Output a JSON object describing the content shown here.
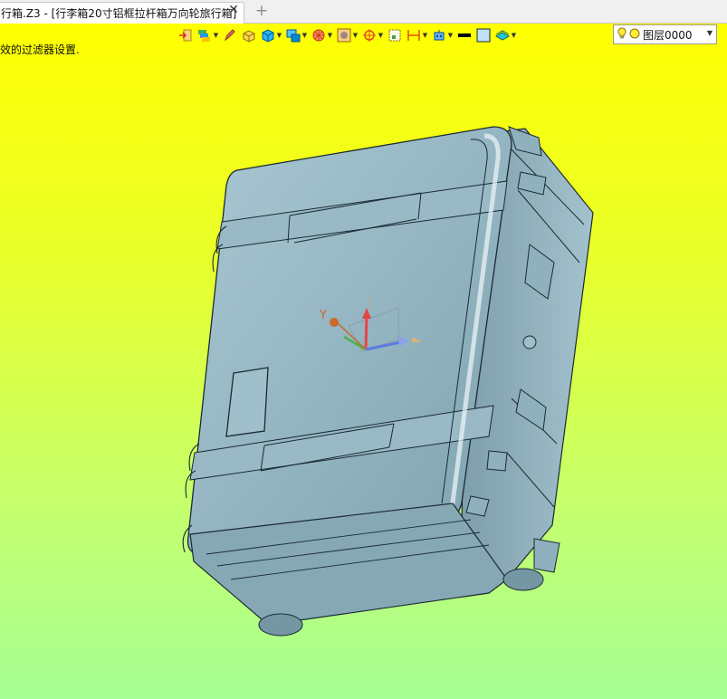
{
  "tab": {
    "title": "行箱.Z3 - [行李箱20寸铝框拉杆箱万向轮旅行箱]",
    "close_glyph": "✕",
    "new_tab_glyph": "+"
  },
  "status": {
    "filter_message": "效的过滤器设置."
  },
  "toolbar": {
    "icons": [
      "exit-sketch-icon",
      "layer-manager-icon",
      "pencil-icon",
      "solid-box-icon",
      "cube-icon",
      "view-icon",
      "render-sphere-icon",
      "texture-icon",
      "snap-target-icon",
      "box-select-icon",
      "dimension-icon",
      "robot-icon",
      "line-color-icon",
      "fill-color-icon",
      "surface-layer-icon"
    ],
    "layer_select": {
      "value": "图层0000",
      "bulb_icon": "lightbulb-icon",
      "circle_icon": "layer-circle-icon"
    }
  },
  "triad": {
    "y_label": "Y"
  },
  "colors": {
    "viewport_top": "#ffff00",
    "viewport_bottom": "#a6ff94",
    "model_fill": "#8fb4c2",
    "model_edge": "#1a2a33"
  }
}
